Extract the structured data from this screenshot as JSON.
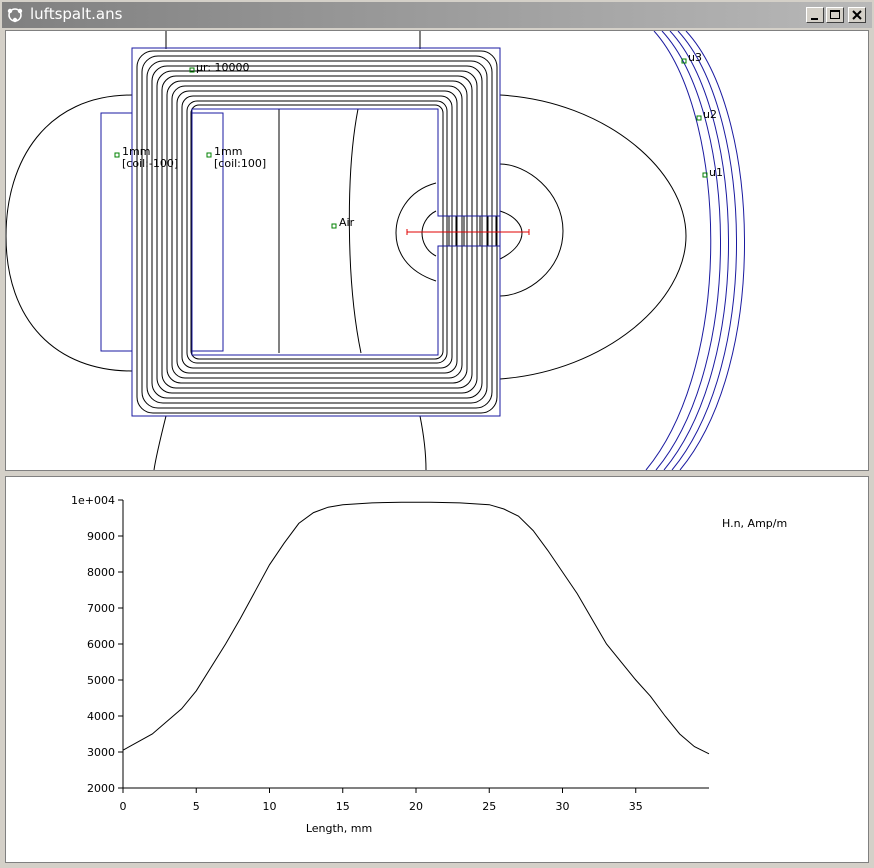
{
  "window": {
    "title": "luftspalt.ans",
    "controls": {
      "minimize": "minimize",
      "maximize": "maximize",
      "close": "close"
    }
  },
  "field_view": {
    "labels": [
      {
        "name": "label-mu-core",
        "text": "μr: 10000"
      },
      {
        "name": "label-coil-left-width",
        "text": "1mm"
      },
      {
        "name": "label-coil-left-current",
        "text": "[coil:-100]"
      },
      {
        "name": "label-coil-right-width",
        "text": "1mm"
      },
      {
        "name": "label-coil-right-current",
        "text": "[coil:100]"
      },
      {
        "name": "label-air",
        "text": "Air"
      },
      {
        "name": "label-u1",
        "text": "u1"
      },
      {
        "name": "label-u2",
        "text": "u2"
      },
      {
        "name": "label-u3",
        "text": "u3"
      }
    ]
  },
  "chart_data": {
    "type": "line",
    "title": "",
    "legend": "H.n, Amp/m",
    "xlabel": "Length, mm",
    "ylabel": "",
    "xlim": [
      0,
      40
    ],
    "ylim": [
      2000,
      10000
    ],
    "x_ticks": [
      "0",
      "5",
      "10",
      "15",
      "20",
      "25",
      "30",
      "35"
    ],
    "y_ticks": [
      "2000",
      "3000",
      "4000",
      "5000",
      "6000",
      "7000",
      "8000",
      "9000",
      "1e+004"
    ],
    "series": [
      {
        "name": "H.n, Amp/m",
        "x": [
          0,
          2,
          4,
          5,
          7,
          8,
          10,
          11,
          12,
          13,
          14,
          15,
          17,
          19,
          21,
          23,
          25,
          26,
          27,
          28,
          29,
          30,
          31,
          32,
          33,
          35,
          36,
          37,
          38,
          39,
          40
        ],
        "y": [
          3050,
          3500,
          4200,
          4700,
          6000,
          6700,
          8200,
          8800,
          9350,
          9650,
          9800,
          9870,
          9920,
          9940,
          9940,
          9920,
          9870,
          9750,
          9550,
          9150,
          8600,
          8000,
          7400,
          6700,
          6000,
          5000,
          4550,
          4000,
          3500,
          3150,
          2950
        ]
      }
    ],
    "colors": {
      "line": "#000000",
      "axis": "#000000"
    }
  }
}
